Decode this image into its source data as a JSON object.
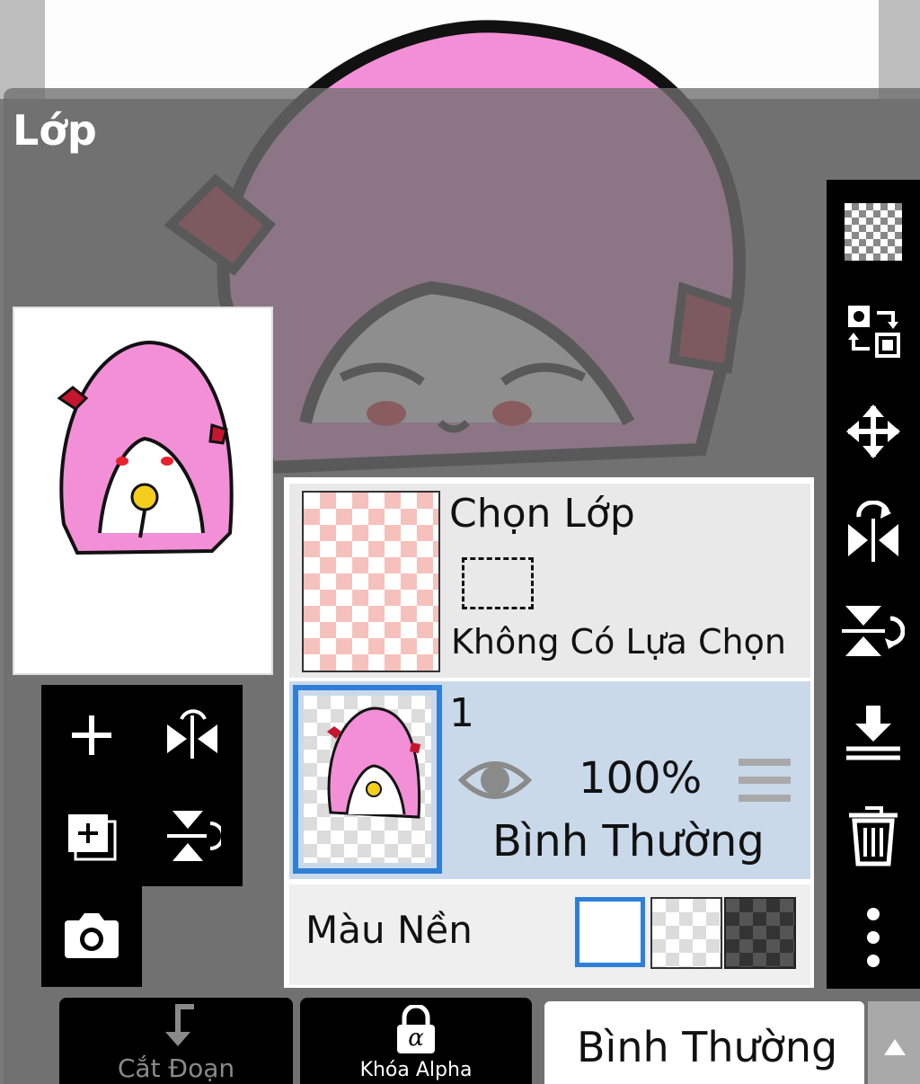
{
  "panel": {
    "title": "Lớp"
  },
  "selection_layer": {
    "title": "Chọn Lớp",
    "status": "Không Có Lựa Chọn"
  },
  "layer": {
    "number": "1",
    "opacity": "100%",
    "blend": "Bình Thường",
    "visible_icon": "eye-icon",
    "menu_icon": "drag-handle-icon"
  },
  "background": {
    "label": "Màu Nền",
    "options": [
      "white",
      "transparent",
      "dark-checker"
    ],
    "selected": "white"
  },
  "bottom_bar": {
    "clip_label": "Cắt Đoạn",
    "alpha_label": "Khóa Alpha",
    "blend_mode": "Bình Thường",
    "clip_icon": "arrow-down-turn-icon",
    "alpha_icon": "lock-alpha-icon",
    "alpha_symbol": "α",
    "expand_icon": "triangle-up-icon"
  },
  "left_tools": [
    "add-layer-icon",
    "flip-horizontal-icon",
    "add-copy-layer-icon",
    "flip-vertical-icon",
    "camera-icon"
  ],
  "right_tools": [
    "transparency-checker-icon",
    "swap-layers-icon",
    "move-icon",
    "rotate-flip-icon",
    "flip-rotate-vertical-icon",
    "merge-down-icon",
    "trash-icon",
    "more-vertical-icon"
  ],
  "colors": {
    "accent": "#2f7fd8",
    "selected_row": "#c9d9ea",
    "hair": "#f38fd6"
  }
}
